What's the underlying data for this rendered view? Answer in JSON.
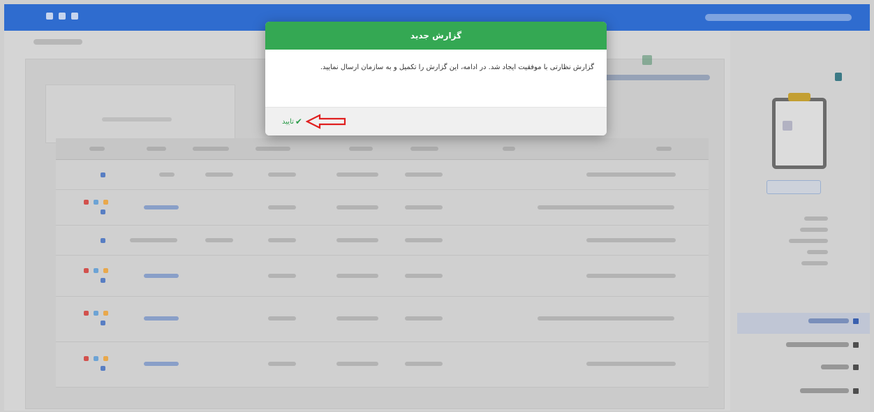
{
  "modal": {
    "title": "گزارش جدید",
    "message": "گزارش نظارتی با موفقیت ایجاد شد. در ادامه، این گزارش را تکمیل و به سازمان ارسال نمایید.",
    "confirm_label": "تایید",
    "confirm_icon": "check-icon",
    "header_color": "#34a853",
    "annotation_color": "#e02020"
  },
  "colors": {
    "topbar": "#2f6fd6",
    "accent_green": "#34a853"
  }
}
